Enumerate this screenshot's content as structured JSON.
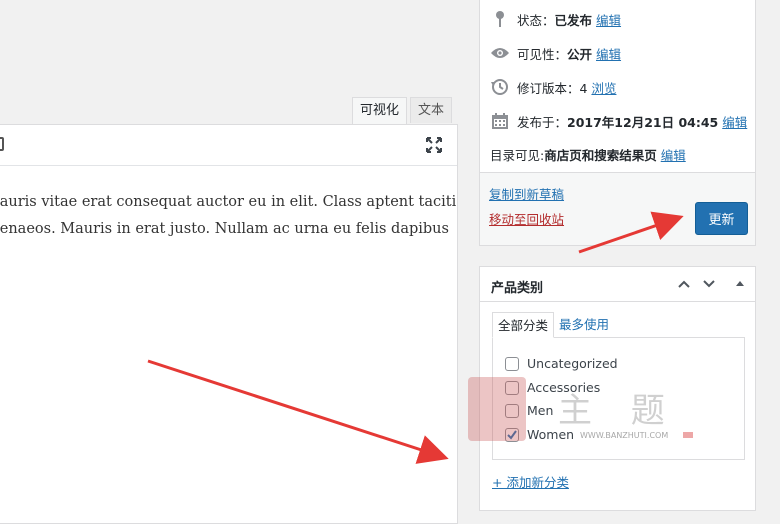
{
  "editor": {
    "tabs": {
      "visual": "可视化",
      "text": "文本"
    },
    "content_lines": [
      "mauris vitae erat consequat auctor eu in elit. Class aptent taciti",
      "menaeos. Mauris in erat justo. Nullam ac urna eu felis dapibus"
    ]
  },
  "publish": {
    "status_label": "状态：",
    "status_value": "已发布",
    "visibility_label": "可见性：",
    "visibility_value": "公开",
    "revisions_label": "修订版本：4",
    "revisions_link": "浏览",
    "published_label": "发布于：",
    "published_value": "2017年12月21日 04:45",
    "catalog_label": "目录可见: ",
    "catalog_value": "商店页和搜索结果页",
    "edit_link": "编辑",
    "copy_draft": "复制到新草稿",
    "move_trash": "移动至回收站",
    "update_button": "更新",
    "accent_color": "#2271b1"
  },
  "categories": {
    "title": "产品类别",
    "tab_all": "全部分类",
    "tab_popular": "最多使用",
    "items": [
      {
        "label": "Uncategorized",
        "checked": false
      },
      {
        "label": "Accessories",
        "checked": false
      },
      {
        "label": "Men",
        "checked": false
      },
      {
        "label": "Women",
        "checked": true
      }
    ],
    "add_new": "+ 添加新分类"
  },
  "watermark": {
    "text": "主 题",
    "url": "WWW.BANZHUTI.COM"
  },
  "icons": [
    "pin-icon",
    "eye-icon",
    "history-icon",
    "calendar-icon",
    "fullscreen-icon",
    "chevron-up-icon",
    "chevron-down-icon",
    "collapse-triangle-icon",
    "checkmark-icon",
    "arrow-annotation"
  ]
}
